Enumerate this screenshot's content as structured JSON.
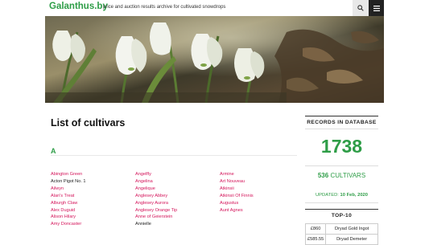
{
  "header": {
    "logo": "Galanthus.by",
    "tagline": "price and auction results archive for cultivated snowdrops"
  },
  "main": {
    "title": "List of cultivars",
    "letter": "A",
    "columns": [
      [
        {
          "label": "Abington Green",
          "linked": true
        },
        {
          "label": "Acton Pigot No. 1",
          "linked": false
        },
        {
          "label": "Ailwyn",
          "linked": true
        },
        {
          "label": "Alan's Treat",
          "linked": true
        },
        {
          "label": "Alburgh Claw",
          "linked": true
        },
        {
          "label": "Alex Duguid",
          "linked": true
        },
        {
          "label": "Alison Hilary",
          "linked": true
        },
        {
          "label": "Amy Doncaster",
          "linked": true
        }
      ],
      [
        {
          "label": "Angelfly",
          "linked": true
        },
        {
          "label": "Angelina",
          "linked": true
        },
        {
          "label": "Angelique",
          "linked": true
        },
        {
          "label": "Anglesey Abbey",
          "linked": true
        },
        {
          "label": "Anglesey Aurora",
          "linked": true
        },
        {
          "label": "Anglesey Orange Tip",
          "linked": true
        },
        {
          "label": "Anne of Geierstein",
          "linked": true
        },
        {
          "label": "Annielle",
          "linked": false
        }
      ],
      [
        {
          "label": "Armine",
          "linked": true
        },
        {
          "label": "Art Nouveau",
          "linked": true
        },
        {
          "label": "Atkinsii",
          "linked": true
        },
        {
          "label": "Atkinsii Of Finnis",
          "linked": true
        },
        {
          "label": "Augustus",
          "linked": true
        },
        {
          "label": "Aunt Agnes",
          "linked": true
        }
      ]
    ]
  },
  "sidebar": {
    "records_title": "RECORDS IN DATABASE",
    "records_count": "1738",
    "cultivars_count": "536",
    "cultivars_label": "CULTIVARS",
    "updated_label": "UPDATED:",
    "updated_date": "10 Feb, 2020",
    "top_title": "TOP-10",
    "top_rows": [
      {
        "price": "£860",
        "name": "Dryad Gold Ingot"
      },
      {
        "price": "£585.55",
        "name": "Dryad Demeter"
      }
    ]
  },
  "icons": {
    "search": "search-icon",
    "menu": "hamburger-menu-icon"
  },
  "colors": {
    "brand": "#2e9d47",
    "link": "#d4145a",
    "menu_bg": "#222222"
  }
}
